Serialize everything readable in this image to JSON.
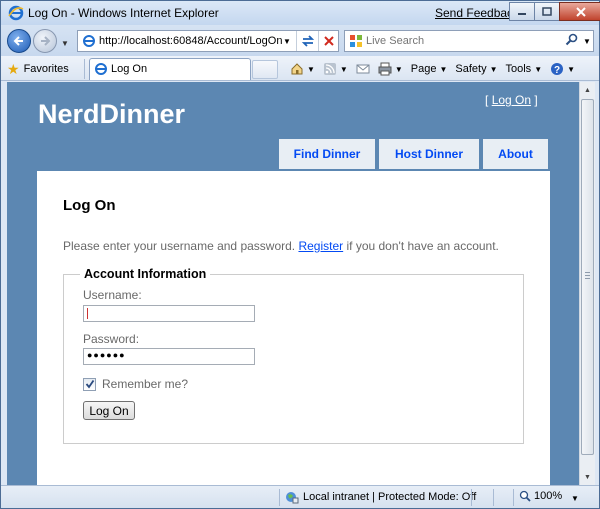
{
  "browser": {
    "title": "Log On - Windows Internet Explorer",
    "send_feedback": "Send Feedback",
    "url": "http://localhost:60848/Account/LogOn",
    "search_placeholder": "Live Search",
    "favorites_label": "Favorites",
    "tab_title": "Log On",
    "commands": {
      "page": "Page",
      "safety": "Safety",
      "tools": "Tools"
    },
    "status": {
      "zone": "Local intranet | Protected Mode: Off",
      "zoom": "100%"
    }
  },
  "site": {
    "title": "NerdDinner",
    "login_bracket_open": "[",
    "login_link": "Log On",
    "login_bracket_close": "]",
    "menu": [
      {
        "label": "Find Dinner"
      },
      {
        "label": "Host Dinner"
      },
      {
        "label": "About"
      }
    ]
  },
  "form": {
    "heading": "Log On",
    "intro_before": "Please enter your username and password. ",
    "intro_link": "Register",
    "intro_after": " if you don't have an account.",
    "legend": "Account Information",
    "username_label": "Username:",
    "username_value": "",
    "password_label": "Password:",
    "password_mask": "●●●●●●",
    "remember_label": "Remember me?",
    "remember_checked": true,
    "submit_label": "Log On"
  },
  "colors": {
    "page_background": "#5c87b2",
    "menu_tab_background": "#e8eef4",
    "link": "#034af3",
    "muted_text": "#696969"
  },
  "icons": [
    "ie-logo-icon",
    "back-arrow-icon",
    "forward-arrow-icon",
    "page-icon",
    "refresh-icon",
    "stop-icon",
    "live-search-icon",
    "search-icon",
    "favorites-star-icon",
    "home-icon",
    "feeds-icon",
    "mail-icon",
    "print-icon",
    "help-icon",
    "globe-zone-icon",
    "zoom-icon"
  ]
}
